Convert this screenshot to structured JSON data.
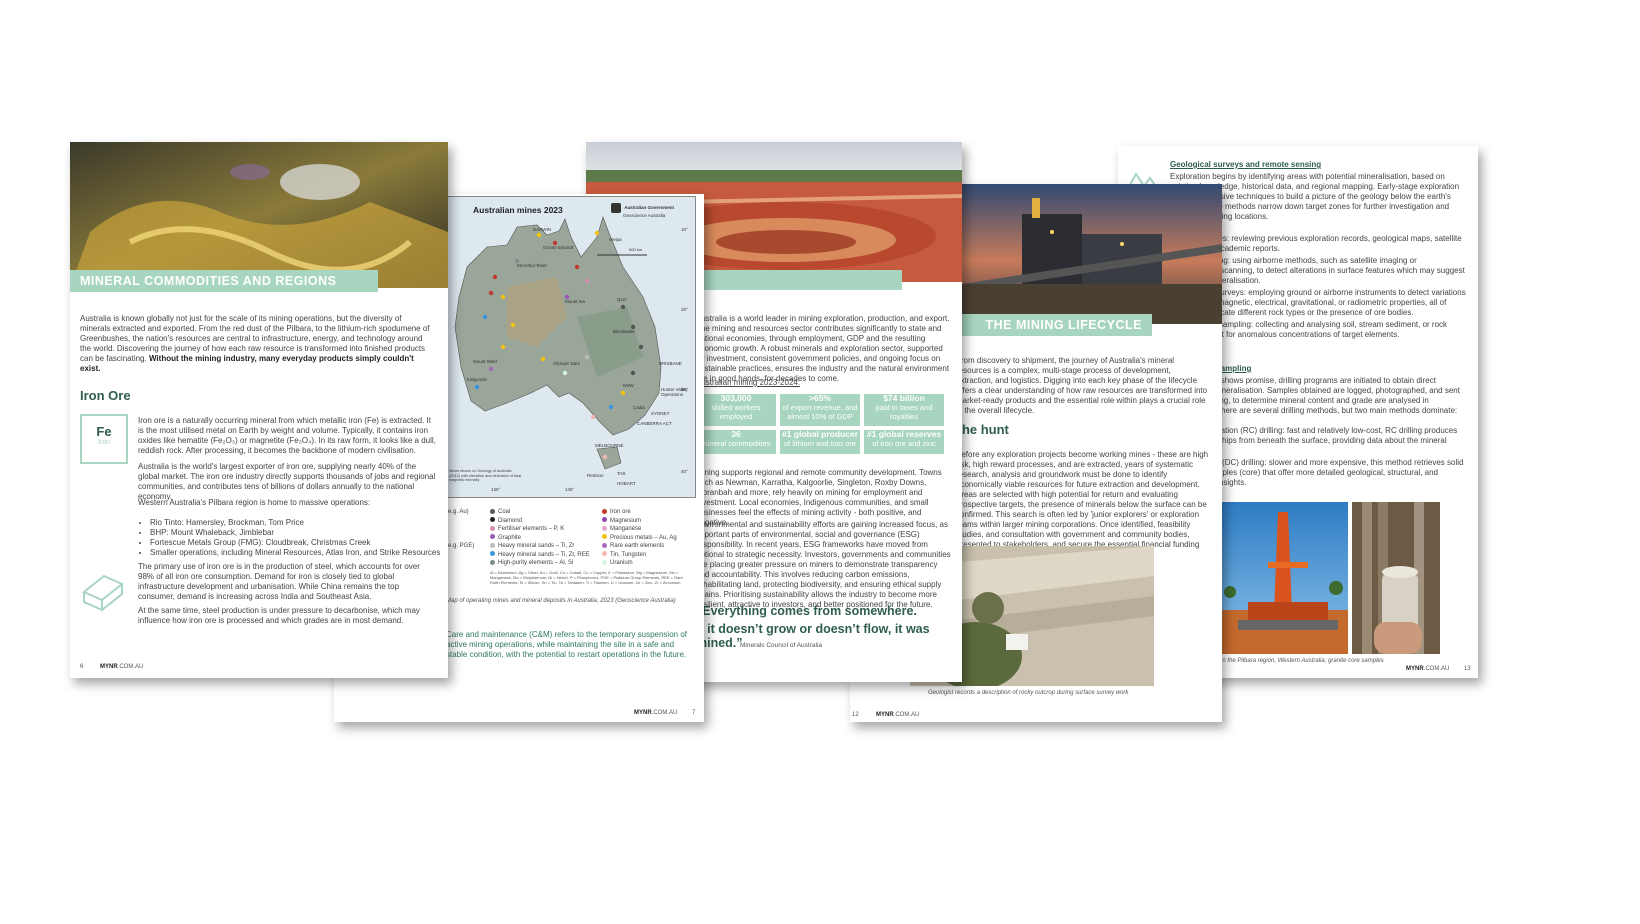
{
  "page_far_right": {
    "heading": "Geological surveys and remote sensing",
    "intro": "Exploration begins by identifying areas with potential mineralisation, based on existing knowledge, historical data, and regional mapping. Early-stage exploration uses non-invasive techniques to build a picture of the geology below the earth's surface. These methods narrow down target zones for further investigation and help guide drilling locations.",
    "item1": "Desktop studies: reviewing previous exploration records, geological maps, satellite imagery and academic reports.",
    "item2": "Remote sensing: using airborne methods, such as satellite imaging or hyperspectral scanning, to detect alterations in surface features which may suggest underlying mineralisation.",
    "item3": "Geophysical surveys: employing ground or airborne instruments to detect variations in the earth's magnetic, electrical, gravitational, or radiometric properties, all of which can indicate different rock types or the presence of ore bodies.",
    "item4": "Geochemical sampling: collecting and analysing soil, stream sediment, or rock samples to test for anomalous concentrations of target elements.",
    "sub2": "Drilling and sampling",
    "drill_intro": "Once an area shows promise, drilling programs are initiated to obtain direct evidence of mineralisation. Samples obtained are logged, photographed, and sent for assay testing, to determine mineral content and grade are analysed in laboratories. There are several drilling methods, but two main methods dominate:",
    "rc": "Reverse circulation (RC) drilling: fast and relatively low-cost, RC drilling produces crushed rock chips from beneath the surface, providing data about the mineral content.",
    "dc": "Diamond core (DC) drilling: slower and more expensive, this method retrieves solid cylindrical samples (core) that offer more detailed geological, structural, and metallurgical insights.",
    "caption": "Drilling exploration in the Pilbara region, Western Australia; granite core samples",
    "brand": "MYNR",
    "domain": ".COM.AU",
    "page_no": "13"
  },
  "page_lifecycle": {
    "title": "THE MINING LIFECYCLE",
    "intro": "From discovery to shipment, the journey of Australia's mineral resources is a complex, multi-stage process of development, extraction, and logistics. Digging into each key phase of the lifecycle offers a clear understanding of how raw resources are transformed into market-ready products and the essential role within plays a crucial role in the overall lifecycle.",
    "subhead": "The hunt",
    "body": "Before any exploration projects become working mines - these are high risk, high reward processes, and are extracted, years of systematic research, analysis and groundwork must be done to identify economically viable resources for future extraction and development. Areas are selected with high potential for return and evaluating prospective targets, the presence of minerals below the surface can be confirmed. This search is often led by 'junior explorers' or exploration teams within larger mining corporations. Once identified, feasibility studies, and consultation with government and community bodies, presented to stakeholders, and secure the essential financial funding procured.",
    "caption": "Geologist records a description of rocky outcrop during surface survey work",
    "brand": "MYNR",
    "domain": ".COM.AU",
    "page_no": "12"
  },
  "page_economy": {
    "intro": "Australia is a world leader in mining exploration, production, and export. The mining and resources sector contributes significantly to state and national economies, through employment, GDP and the resulting economic growth. A robust minerals and exploration sector, supported by investment, consistent government policies, and ongoing focus on sustainable practices, ensures the industry and the natural environment are in good hands, for decades to come.",
    "year_label": "Australian mining 2023-2024:",
    "stats": [
      {
        "big": "303,000",
        "small": "skilled workers employed"
      },
      {
        "big": ">65%",
        "small": "of export revenue, and almost 10% of GDP"
      },
      {
        "big": "$74 billion",
        "small": "paid in taxes and royalties"
      },
      {
        "big": "36",
        "small": "mineral commodities"
      },
      {
        "big": "#1 global producer",
        "small": "of lithium and iron ore"
      },
      {
        "big": "#1 global reserves",
        "small": "of iron ore and zinc"
      }
    ],
    "para2": "Mining supports regional and remote community development. Towns such as Newman, Karratha, Kalgoorlie, Singleton, Roxby Downs, Moranbah and more, rely heavily on mining for employment and investment. Local economies, Indigenous communities, and small businesses feel the effects of mining activity - both positive, and negative.",
    "para3": "Environmental and sustainability efforts are gaining increased focus, as important parts of environmental, social and governance (ESG) responsibility. In recent years, ESG frameworks have moved from optional to strategic necessity. Investors, governments and communities are placing greater pressure on miners to demonstrate transparency and accountability. This involves reducing carbon emissions, rehabilitating land, protecting biodiversity, and ensuring ethical supply chains. Prioritising sustainability allows the industry to become more resilient, attractive to investors, and better positioned for the future.",
    "quote_line1": "“Everything comes from somewhere.",
    "quote_line2": "If it doesn’t grow or doesn’t flow, it was mined.”",
    "quote_source": "Minerals Council of Australia"
  },
  "page_map": {
    "map_title": "Australian mines 2023",
    "agency_line1": "Australian Government",
    "agency_line2": "Geoscience Australia",
    "places": [
      "DARWIN",
      "Groote Eylandt",
      "Weipa",
      "McArthur River",
      "Mount Isa",
      "Blackwater",
      "BRISBANE",
      "Olympic Dam",
      "Hunter Valley Operations",
      "SYDNEY",
      "CANBERRA ACT",
      "MELBOURNE",
      "Renison",
      "HOBART",
      "Kalgoorlie",
      "Mount Weld",
      "QLD",
      "TAS",
      "NSW",
      "Cadia"
    ],
    "scale_label": "500 km",
    "source_note": "Mines shown on Geology of Australia (2012) with elevation and derivative of total magnetic intensity",
    "lat_ticks": [
      "10°",
      "20°",
      "30°",
      "40°"
    ],
    "lon_ticks": [
      "130°",
      "140°"
    ],
    "legend_left": [
      "(e.g. Au)",
      "",
      "",
      "",
      "(e.g. PGE)"
    ],
    "legend_items": [
      {
        "label": "Coal",
        "color": "#555555"
      },
      {
        "label": "Iron ore",
        "color": "#c0392b"
      },
      {
        "label": "Diamond",
        "color": "#222222"
      },
      {
        "label": "Magnesium",
        "color": "#8e44ad"
      },
      {
        "label": "Fertiliser elements – P, K",
        "color": "#d98cb3"
      },
      {
        "label": "Manganese",
        "color": "#e6a6c9"
      },
      {
        "label": "Graphite",
        "color": "#9b59b6"
      },
      {
        "label": "Precious metals – Au, Ag",
        "color": "#f1c40f"
      },
      {
        "label": "Heavy mineral sands – Ti, Zr",
        "color": "#bbbbbb"
      },
      {
        "label": "Rare earth elements",
        "color": "#a569bd"
      },
      {
        "label": "Heavy mineral sands – Ti, Zr, REE",
        "color": "#3498db"
      },
      {
        "label": "Tin, Tungsten",
        "color": "#f5b7b1"
      },
      {
        "label": "High-purity elements – Al, Si",
        "color": "#7f8c8d"
      },
      {
        "label": "Uranium",
        "color": "#d5f5e3"
      }
    ],
    "abbrev": "Al = Aluminium, Ag = Silver, Au = Gold, Co = Cobalt, Cu = Copper, K = Potassium, Mg = Magnesium, Mn = Manganese, Mo = Molybdenum, Ni = Nickel, P = Phosphorus, PGE = Platinum Group Elements, REE = Rare Earth Elements, Si = Silicon, Sn = Tin, Ta = Tantalum, Ti = Titanium, U = Uranium, Zn = Zinc, Zr = Zirconium",
    "caption": "Map of operating mines and mineral deposits in Australia, 2023 (Geoscience Australia)",
    "cm_text": "Care and maintenance (C&M) refers to the temporary suspension of active mining operations, while maintaining the site in a safe and stable condition, with the potential to restart operations in the future.",
    "brand": "MYNR",
    "domain": ".COM.AU",
    "page_no": "7"
  },
  "page_left": {
    "title": "MINERAL COMMODITIES AND REGIONS",
    "intro": "Australia is known globally not just for the scale of its mining operations, but the diversity of minerals extracted and exported. From the red dust of the Pilbara, to the lithium-rich spodumene of Greenbushes, the nation's resources are central to infrastructure, energy, and technology around the world. Discovering the journey of how each raw resource is transformed into finished products can be fascinating.",
    "intro_bold": "Without the mining industry, many everyday products simply couldn't exist.",
    "section": "Iron Ore",
    "tile_symbol": "Fe",
    "tile_name": "Iron",
    "p1": "Iron ore is a naturally occurring mineral from which metallic iron (Fe) is extracted. It is the most utilised metal on Earth by weight and volume. Typically, it contains iron oxides like hematite (Fe₂O₃) or magnetite (Fe₃O₄). In its raw form, it looks like a dull, reddish rock. After processing, it becomes the backbone of modern civilisation.",
    "p2": "Australia is the world's largest exporter of iron ore, supplying nearly 40% of the global market. The iron ore industry directly supports thousands of jobs and regional communities, and contributes tens of billions of dollars annually to the national economy.",
    "p3": "Western Australia's Pilbara region is home to massive operations:",
    "bullets": [
      "Rio Tinto: Hamersley, Brockman, Tom Price",
      "BHP: Mount Whaleback, Jimblebar",
      "Fortescue Metals Group (FMG): Cloudbreak, Christmas Creek",
      "Smaller operations, including Mineral Resources, Atlas Iron, and Strike Resources"
    ],
    "p4": "The primary use of iron ore is in the production of steel, which accounts for over 98% of all iron ore consumption. Demand for iron is closely tied to global infrastructure development and urbanisation. While China remains the top consumer, demand is increasing across India and Southeast Asia.",
    "p5": "At the same time, steel production is under pressure to decarbonise, which may influence how iron ore is processed and which grades are in most demand.",
    "brand": "MYNR",
    "domain": ".COM.AU",
    "page_no": "6"
  },
  "colors": {
    "accent": "#a8d5c0",
    "heading": "#2f5e4e"
  }
}
